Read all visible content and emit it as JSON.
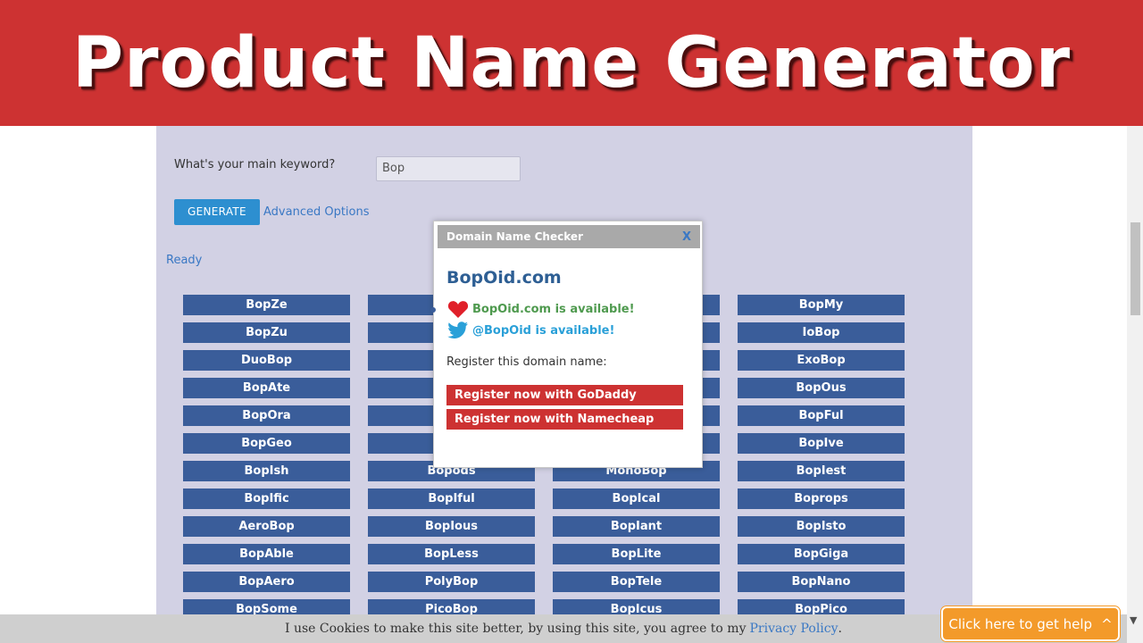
{
  "banner": {
    "title": "Product Name Generator",
    "color": "#cd3232"
  },
  "form": {
    "keyword_label": "What's your main keyword?",
    "keyword_value": "Bop",
    "generate_label": "GENERATE",
    "advanced_label": "Advanced Options",
    "status": "Ready"
  },
  "names": [
    "BopZe",
    "",
    "",
    "BopMy",
    "BopZu",
    "",
    "",
    "IoBop",
    "DuoBop",
    "",
    "",
    "ExoBop",
    "BopAte",
    "",
    "",
    "BopOus",
    "BopOra",
    "",
    "",
    "BopFul",
    "BopGeo",
    "",
    "",
    "BopIve",
    "BopIsh",
    "Bopods",
    "MonoBop",
    "BopIest",
    "BopIfic",
    "BopIful",
    "BopIcal",
    "Boprops",
    "AeroBop",
    "BopIous",
    "BopIant",
    "BopIsto",
    "BopAble",
    "BopLess",
    "BopLite",
    "BopGiga",
    "BopAero",
    "PolyBop",
    "BopTele",
    "BopNano",
    "BopSome",
    "PicoBop",
    "BopIcus",
    "BopPico"
  ],
  "modal": {
    "title": "Domain Name Checker",
    "close": "X",
    "domain": "BopOid.com",
    "domain_status": "BopOid.com is available!",
    "twitter_status": "@BopOid is available!",
    "register_label": "Register this domain name:",
    "godaddy_label": "Register now with GoDaddy",
    "namecheap_label": "Register now with Namecheap"
  },
  "cookie": {
    "text": "I use Cookies to make this site better, by using this site, you agree to my",
    "link": "Privacy Policy",
    "period": "."
  },
  "help": {
    "label": "Click here to get help",
    "chevron": "^"
  }
}
